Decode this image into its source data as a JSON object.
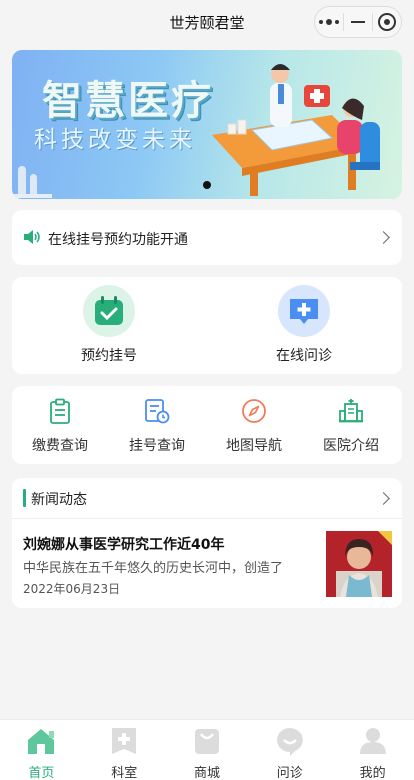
{
  "header": {
    "title": "世芳颐君堂"
  },
  "banner": {
    "headline": "智慧医疗",
    "subline": "科技改变未来",
    "page_count": 1,
    "active_page": 1
  },
  "notice": {
    "text": "在线挂号预约功能开通"
  },
  "primary_services": [
    {
      "label": "预约挂号",
      "icon": "calendar-check-icon"
    },
    {
      "label": "在线问诊",
      "icon": "chat-plus-icon"
    }
  ],
  "services": [
    {
      "label": "缴费查询",
      "icon": "clipboard-icon"
    },
    {
      "label": "挂号查询",
      "icon": "schedule-icon"
    },
    {
      "label": "地图导航",
      "icon": "compass-icon"
    },
    {
      "label": "医院介绍",
      "icon": "hospital-icon"
    }
  ],
  "news": {
    "section_title": "新闻动态",
    "items": [
      {
        "title": "刘婉娜从事医学研究工作近40年",
        "summary": "中华民族在五千年悠久的历史长河中，创造了",
        "date": "2022年06月23日"
      }
    ]
  },
  "tabbar": {
    "items": [
      {
        "label": "首页",
        "icon": "home-icon",
        "active": true
      },
      {
        "label": "科室",
        "icon": "department-icon",
        "active": false
      },
      {
        "label": "商城",
        "icon": "shopping-bag-icon",
        "active": false
      },
      {
        "label": "问诊",
        "icon": "chat-bubble-icon",
        "active": false
      },
      {
        "label": "我的",
        "icon": "user-icon",
        "active": false
      }
    ]
  },
  "colors": {
    "accent": "#27ae7a",
    "blue": "#4a8ef0",
    "orange": "#f07a5a"
  }
}
